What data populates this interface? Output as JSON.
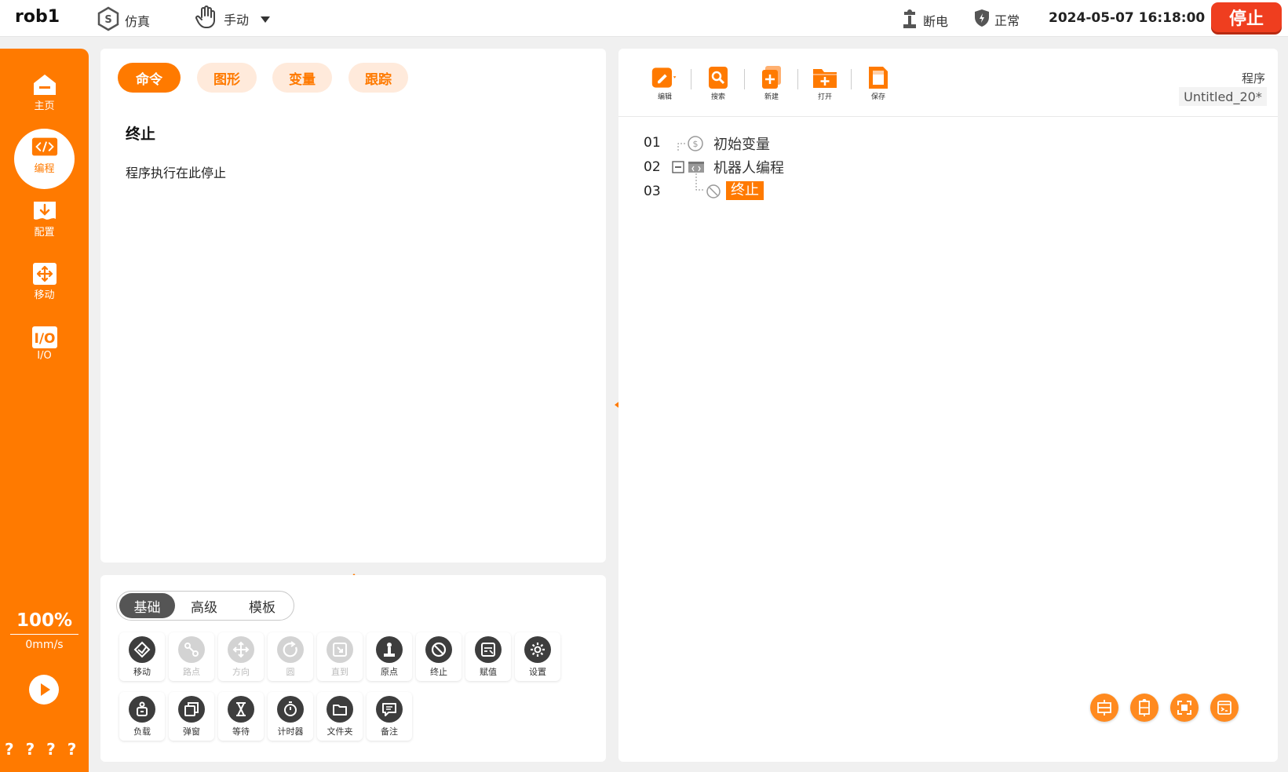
{
  "header": {
    "robot_name": "rob1",
    "sim_label": "仿真",
    "mode_label": "手动",
    "power_label": "断电",
    "status_label": "正常",
    "datetime": "2024-05-07 16:18:00",
    "stop_label": "停止"
  },
  "sidebar": {
    "items": [
      {
        "label": "主页",
        "icon": "home-icon"
      },
      {
        "label": "编程",
        "icon": "code-icon"
      },
      {
        "label": "配置",
        "icon": "download-icon"
      },
      {
        "label": "移动",
        "icon": "move-icon"
      },
      {
        "label": "I/O",
        "icon": "io-icon"
      }
    ],
    "speed_percent": "100%",
    "speed_value": "0mm/s",
    "footer": "? ? ? ?"
  },
  "left_panel": {
    "tabs": [
      "命令",
      "图形",
      "变量",
      "跟踪"
    ],
    "title": "终止",
    "description": "程序执行在此停止"
  },
  "palette": {
    "segments": [
      "基础",
      "高级",
      "模板"
    ],
    "row1": [
      {
        "label": "移动",
        "icon": "move-cmd-icon",
        "enabled": true
      },
      {
        "label": "路点",
        "icon": "waypoint-icon",
        "enabled": false
      },
      {
        "label": "方向",
        "icon": "direction-icon",
        "enabled": false
      },
      {
        "label": "圆",
        "icon": "circle-icon",
        "enabled": false
      },
      {
        "label": "直到",
        "icon": "until-icon",
        "enabled": false
      },
      {
        "label": "原点",
        "icon": "origin-icon",
        "enabled": true
      },
      {
        "label": "终止",
        "icon": "stop-icon",
        "enabled": true
      },
      {
        "label": "赋值",
        "icon": "assign-icon",
        "enabled": true
      },
      {
        "label": "设置",
        "icon": "settings-icon",
        "enabled": true
      }
    ],
    "row2": [
      {
        "label": "负载",
        "icon": "payload-icon",
        "enabled": true
      },
      {
        "label": "弹窗",
        "icon": "popup-icon",
        "enabled": true
      },
      {
        "label": "等待",
        "icon": "hourglass-icon",
        "enabled": true
      },
      {
        "label": "计时器",
        "icon": "timer-icon",
        "enabled": true
      },
      {
        "label": "文件夹",
        "icon": "folder-icon",
        "enabled": true
      },
      {
        "label": "备注",
        "icon": "comment-icon",
        "enabled": true
      }
    ]
  },
  "program": {
    "toolbar": [
      {
        "label": "编辑",
        "icon": "edit-icon"
      },
      {
        "label": "搜索",
        "icon": "search-icon"
      },
      {
        "label": "新建",
        "icon": "new-file-icon"
      },
      {
        "label": "打开",
        "icon": "open-folder-icon"
      },
      {
        "label": "保存",
        "icon": "save-icon"
      }
    ],
    "program_label": "程序",
    "program_name": "Untitled_20*",
    "lines": [
      {
        "num": "01",
        "label": "初始变量"
      },
      {
        "num": "02",
        "label": "机器人编程"
      },
      {
        "num": "03",
        "label": "终止"
      }
    ]
  },
  "colors": {
    "accent": "#ff7a00",
    "stop": "#ef3e1f"
  }
}
